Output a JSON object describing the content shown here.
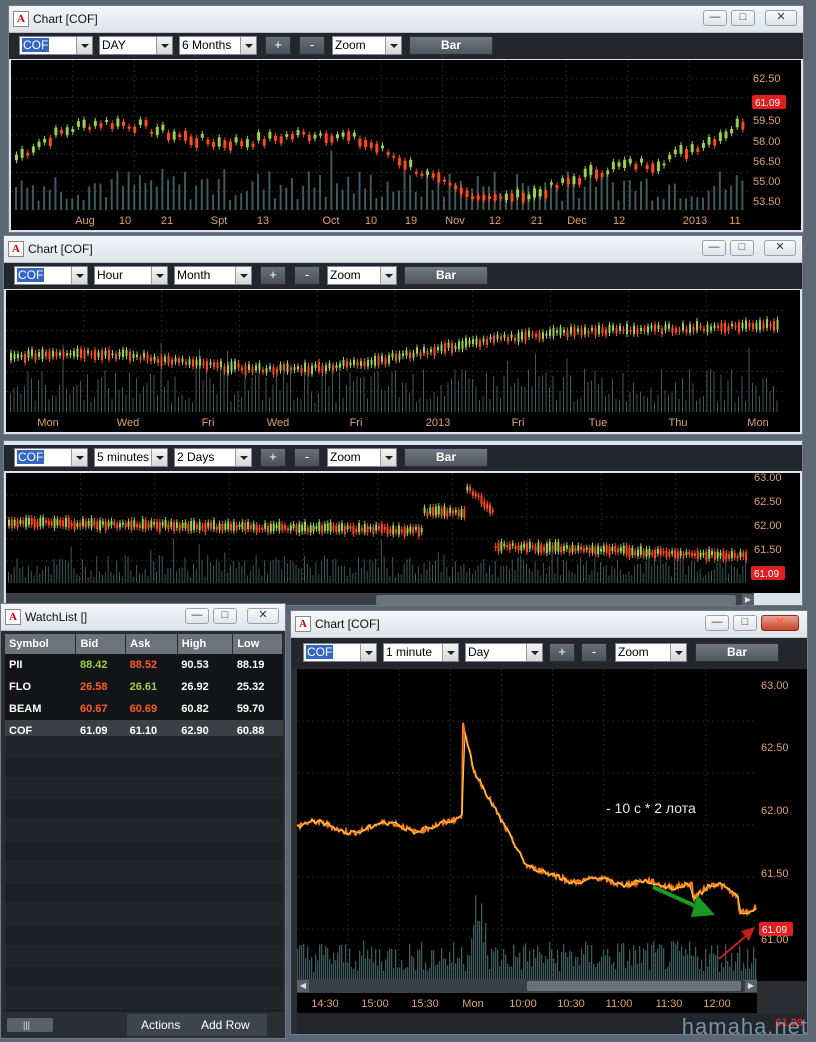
{
  "chart1": {
    "title": "Chart [COF]",
    "symbol": "COF",
    "interval": "DAY",
    "range": "6 Months",
    "plus": "+",
    "minus": "-",
    "zoom": "Zoom",
    "bar": "Bar",
    "y_labels": [
      "62.50",
      "61.09",
      "59.50",
      "58.00",
      "56.50",
      "55.00",
      "53.50"
    ],
    "price_tag": "61.09",
    "x_labels": [
      "Aug",
      "10",
      "21",
      "Spt",
      "13",
      "Oct",
      "10",
      "19",
      "Nov",
      "12",
      "21",
      "Dec",
      "12",
      "2013",
      "11"
    ]
  },
  "chart2": {
    "title": "Chart [COF]",
    "symbol": "COF",
    "interval": "Hour",
    "range": "Month",
    "plus": "+",
    "minus": "-",
    "zoom": "Zoom",
    "bar": "Bar",
    "x_labels": [
      "Mon",
      "Wed",
      "Fri",
      "Wed",
      "Fri",
      "2013",
      "Fri",
      "Tue",
      "Thu",
      "Mon"
    ]
  },
  "chart3": {
    "symbol": "COF",
    "interval": "5 minutes",
    "range": "2 Days",
    "plus": "+",
    "minus": "-",
    "zoom": "Zoom",
    "bar": "Bar",
    "y_labels": [
      "63.00",
      "62.50",
      "62.00",
      "61.50",
      "61.09"
    ],
    "price_tag": "61.09"
  },
  "watchlist": {
    "title": "WatchList []",
    "columns": [
      "Symbol",
      "Bid",
      "Ask",
      "High",
      "Low"
    ],
    "rows": [
      {
        "symbol": "PII",
        "bid": "88.42",
        "ask": "88.52",
        "high": "90.53",
        "low": "88.19",
        "bid_color": "green",
        "ask_color": "red"
      },
      {
        "symbol": "FLO",
        "bid": "26.58",
        "ask": "26.61",
        "high": "26.92",
        "low": "25.32",
        "bid_color": "red",
        "ask_color": "green"
      },
      {
        "symbol": "BEAM",
        "bid": "60.67",
        "ask": "60.69",
        "high": "60.82",
        "low": "59.70",
        "bid_color": "red",
        "ask_color": "red"
      },
      {
        "symbol": "COF",
        "bid": "61.09",
        "ask": "61.10",
        "high": "62.90",
        "low": "60.88",
        "bid_color": "white",
        "ask_color": "white"
      }
    ],
    "actions": "Actions",
    "add_row": "Add Row"
  },
  "chart4": {
    "title": "Chart [COF]",
    "symbol": "COF",
    "interval": "1 minute",
    "range": "Day",
    "plus": "+",
    "minus": "-",
    "zoom": "Zoom",
    "bar": "Bar",
    "y_labels": [
      "63.00",
      "62.50",
      "62.00",
      "61.50",
      "61.09",
      "61.00"
    ],
    "price_tag": "61.09",
    "x_labels": [
      "14:30",
      "15:00",
      "15:30",
      "Mon",
      "10:00",
      "10:30",
      "11:00",
      "11:30",
      "12:00"
    ],
    "annotation": "- 10 с *  2 лота",
    "bottom_price": "61.09"
  },
  "watermark": "hamaha.net",
  "colors": {
    "up": "#9bd04a",
    "down": "#ff4a1a",
    "axis": "#e0a36a",
    "tag": "#e02020",
    "volume": "#3e5a5a"
  }
}
